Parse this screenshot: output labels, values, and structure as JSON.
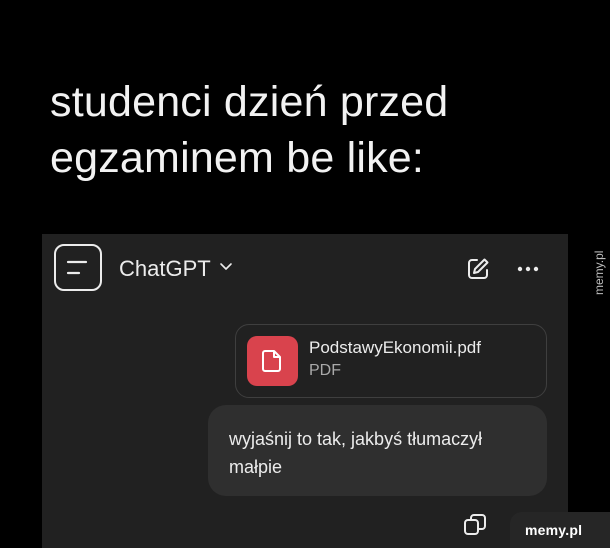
{
  "caption": {
    "line1": "studenci dzień przed",
    "line2": "egzaminem be like:"
  },
  "header": {
    "title": "ChatGPT",
    "menu_icon": "sidebar-menu-icon",
    "edit_icon": "new-chat-icon",
    "more_icon": "more-horizontal-icon"
  },
  "attachment": {
    "file_name": "PodstawyEkonomii.pdf",
    "file_type": "PDF",
    "icon": "document-icon",
    "icon_color": "#d9434d"
  },
  "message": {
    "text": "wyjaśnij to tak, jakbyś tłumaczył małpie"
  },
  "actions": {
    "copy_icon": "copy-icon"
  },
  "watermark": {
    "side_text": "memy.pl",
    "badge_text": "memy.pl"
  },
  "colors": {
    "background": "#000000",
    "app_background": "#212121",
    "bubble": "#2f2f2f",
    "text": "#ececec"
  }
}
